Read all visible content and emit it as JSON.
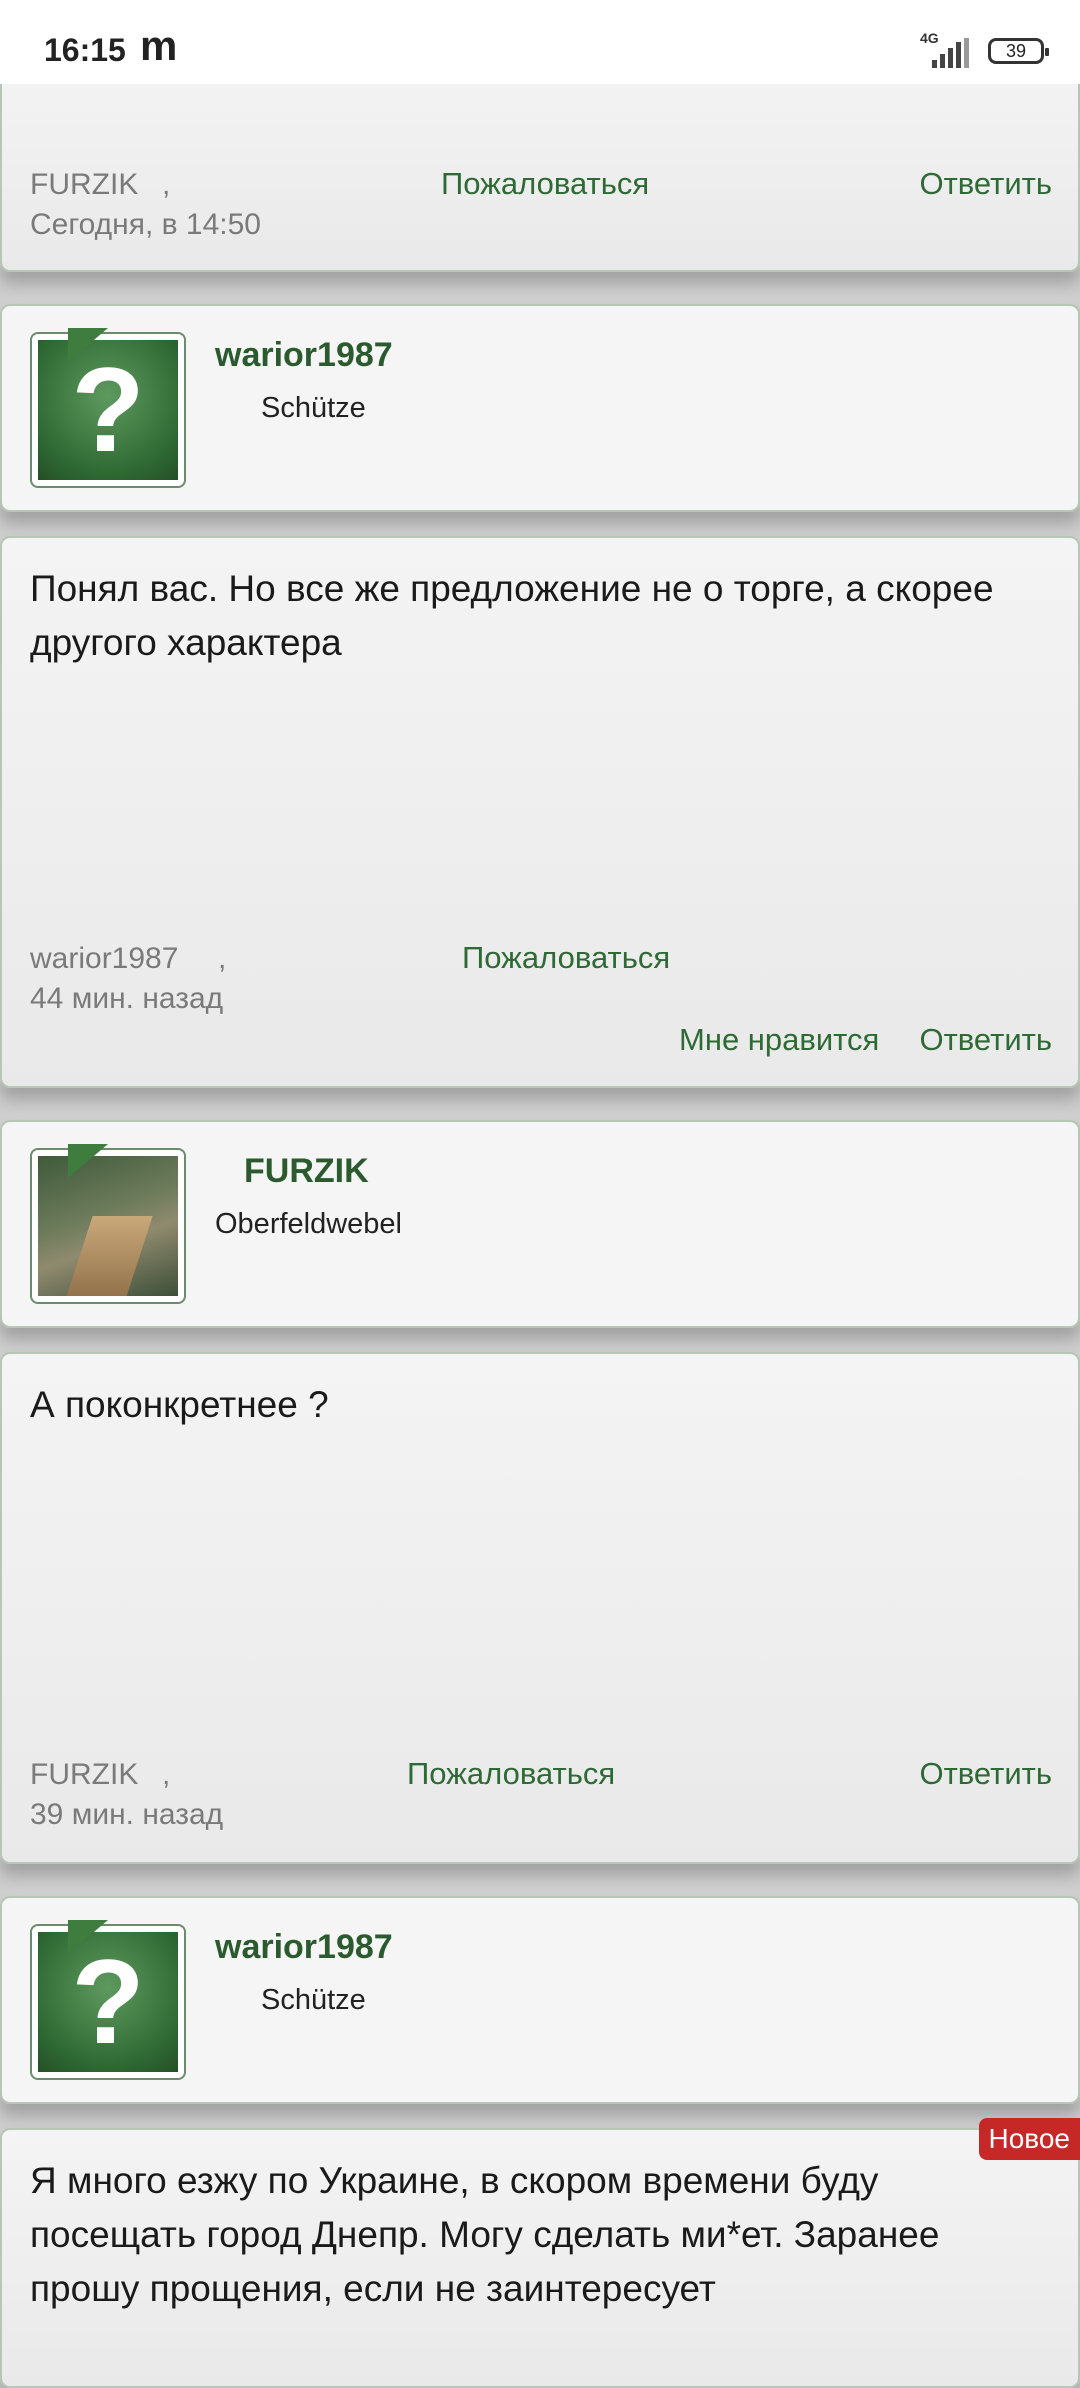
{
  "status_bar": {
    "time": "16:15",
    "app_icon": "m",
    "network": "4G",
    "battery": "39"
  },
  "posts": [
    {
      "author": "FURZIK",
      "sep": ",",
      "time": "Сегодня, в 14:50",
      "report": "Пожаловаться",
      "reply": "Ответить"
    },
    {
      "user": {
        "name": "warior1987",
        "rank": "Schütze"
      },
      "text": "Понял вас. Но все же предложение не о торге, а скорее другого характера",
      "author": "warior1987",
      "sep": ",",
      "time": "44 мин. назад",
      "report": "Пожаловаться",
      "like": "Мне нравится",
      "reply": "Ответить"
    },
    {
      "user": {
        "name": "FURZIK",
        "rank": "Oberfeldwebel"
      },
      "text": "А поконкретнее ?",
      "author": "FURZIK",
      "sep": ",",
      "time": "39 мин. назад",
      "report": "Пожаловаться",
      "reply": "Ответить"
    },
    {
      "user": {
        "name": "warior1987",
        "rank": "Schütze"
      },
      "badge": "Новое",
      "text": "Я много езжу по Украине, в скором времени буду посещать город Днепр. Могу сделать ми*ет. Заранее прошу прощения, если не заинтересует"
    }
  ]
}
